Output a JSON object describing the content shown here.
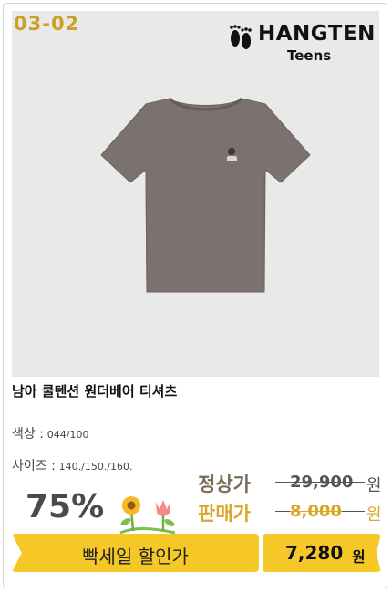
{
  "product_code": "03-02",
  "brand": {
    "name": "HANGTEN",
    "sub": "Teens"
  },
  "product": {
    "title": "남아 쿨텐션 원더베어 티셔츠",
    "color_label": "색상 :",
    "color_value": "044/100",
    "size_label": "사이즈 :",
    "size_value": "140./150./160."
  },
  "pricing": {
    "discount": "75%",
    "regular_label": "정상가",
    "regular_price": "29,900",
    "sale_label": "판매가",
    "sale_price": "8,000",
    "won": "원"
  },
  "banner": {
    "label": "빡세일 할인가",
    "price": "7,280",
    "won": "원"
  },
  "colors": {
    "accent_yellow": "#f5c828",
    "code_gold": "#c9a227",
    "regular_label": "#7a6d5a",
    "sale_label": "#d9a72a",
    "shirt": "#7b7270"
  }
}
